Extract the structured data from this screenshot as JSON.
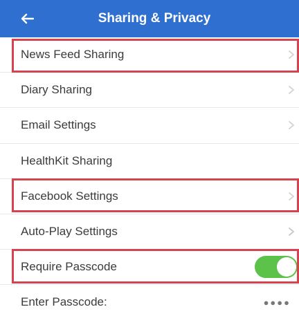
{
  "header": {
    "title": "Sharing & Privacy",
    "back_icon": "arrow-left-icon",
    "background_color": "#2f6fd0"
  },
  "settings": {
    "news_feed_sharing": "News Feed Sharing",
    "diary_sharing": "Diary Sharing",
    "email_settings": "Email Settings",
    "healthkit_sharing": "HealthKit Sharing",
    "facebook_settings": "Facebook Settings",
    "auto_play_settings": "Auto-Play Settings",
    "require_passcode": "Require Passcode",
    "require_passcode_enabled": true,
    "enter_passcode": "Enter Passcode:",
    "passcode_value": "●●●●"
  },
  "colors": {
    "toggle_on": "#5cc24a",
    "highlight_border": "#d6424f"
  }
}
